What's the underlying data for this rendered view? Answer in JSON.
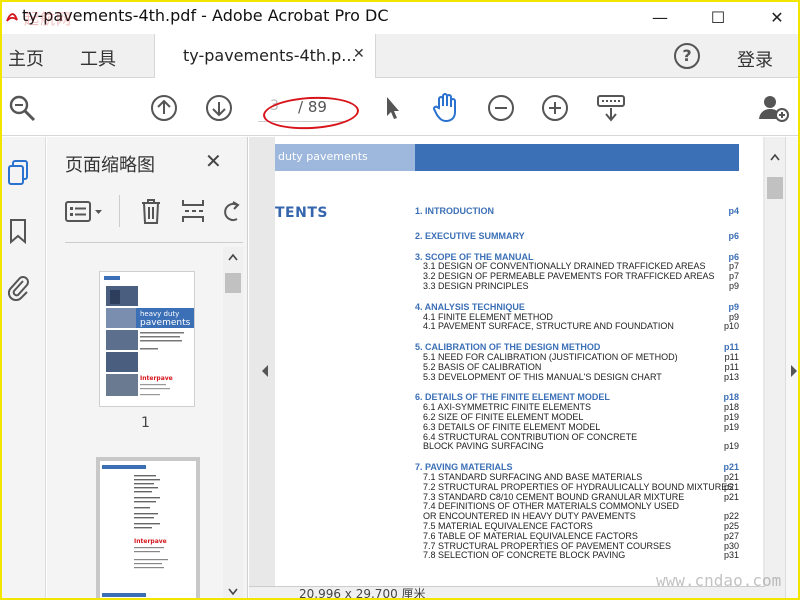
{
  "window": {
    "title": "ty-pavements-4th.pdf - Adobe Acrobat Pro DC",
    "minimize": "—",
    "maximize": "☐",
    "close": "✕"
  },
  "menu": {
    "home": "主页",
    "tools": "工具",
    "login": "登录",
    "help": "?"
  },
  "tab": {
    "label": "ty-pavements-4th.p...",
    "close": "✕"
  },
  "toolbar": {
    "current_page": "3",
    "page_total": "/ 89",
    "icons": [
      "zoom-icon",
      "page-up-icon",
      "page-down-icon",
      "select-cursor-icon",
      "hand-tool-icon",
      "zoom-out-icon",
      "zoom-in-icon",
      "keyboard-scroll-icon",
      "add-user-icon"
    ]
  },
  "thumbnails": {
    "title": "页面缩略图",
    "close": "✕",
    "page1_number": "1"
  },
  "document": {
    "banner": "duty pavements",
    "heading": "TENTS",
    "toc": [
      {
        "kind": "sec",
        "title": "1. INTRODUCTION",
        "page": "p4"
      },
      {
        "kind": "sec",
        "title": "2. EXECUTIVE SUMMARY",
        "page": "p6"
      },
      {
        "kind": "sec",
        "title": "3. SCOPE OF THE MANUAL",
        "page": "p6"
      },
      {
        "kind": "sub",
        "title": "3.1 DESIGN OF CONVENTIONALLY DRAINED TRAFFICKED AREAS",
        "page": "p7"
      },
      {
        "kind": "sub",
        "title": "3.2 DESIGN OF PERMEABLE PAVEMENTS FOR TRAFFICKED AREAS",
        "page": "p7"
      },
      {
        "kind": "sub",
        "title": "3.3 DESIGN PRINCIPLES",
        "page": "p9"
      },
      {
        "kind": "sec",
        "title": "4. ANALYSIS TECHNIQUE",
        "page": "p9"
      },
      {
        "kind": "sub",
        "title": "4.1 FINITE ELEMENT METHOD",
        "page": "p9"
      },
      {
        "kind": "sub",
        "title": "4.1 PAVEMENT SURFACE, STRUCTURE AND FOUNDATION",
        "page": "p10"
      },
      {
        "kind": "sec",
        "title": "5. CALIBRATION OF THE DESIGN METHOD",
        "page": "p11"
      },
      {
        "kind": "sub",
        "title": "5.1 NEED FOR CALIBRATION (JUSTIFICATION OF METHOD)",
        "page": "p11"
      },
      {
        "kind": "sub",
        "title": "5.2 BASIS OF CALIBRATION",
        "page": "p11"
      },
      {
        "kind": "sub",
        "title": "5.3 DEVELOPMENT OF THIS MANUAL'S DESIGN CHART",
        "page": "p13"
      },
      {
        "kind": "sec",
        "title": "6. DETAILS OF THE FINITE ELEMENT MODEL",
        "page": "p18"
      },
      {
        "kind": "sub",
        "title": "6.1 AXI-SYMMETRIC FINITE ELEMENTS",
        "page": "p18"
      },
      {
        "kind": "sub",
        "title": "6.2 SIZE OF FINITE ELEMENT MODEL",
        "page": "p19"
      },
      {
        "kind": "sub",
        "title": "6.3 DETAILS OF FINITE ELEMENT MODEL",
        "page": "p19"
      },
      {
        "kind": "sub",
        "title": "6.4 STRUCTURAL CONTRIBUTION OF CONCRETE",
        "page": ""
      },
      {
        "kind": "sub",
        "title": "     BLOCK PAVING SURFACING",
        "page": "p19"
      },
      {
        "kind": "sec",
        "title": "7. PAVING MATERIALS",
        "page": "p21"
      },
      {
        "kind": "sub",
        "title": "7.1 STANDARD SURFACING AND BASE MATERIALS",
        "page": "p21"
      },
      {
        "kind": "sub",
        "title": "7.2 STRUCTURAL PROPERTIES OF HYDRAULICALLY BOUND MIXTURES",
        "page": "p21"
      },
      {
        "kind": "sub",
        "title": "7.3 STANDARD C8/10 CEMENT BOUND GRANULAR MIXTURE",
        "page": "p21"
      },
      {
        "kind": "sub",
        "title": "7.4 DEFINITIONS OF OTHER MATERIALS COMMONLY USED",
        "page": ""
      },
      {
        "kind": "sub",
        "title": "     OR ENCOUNTERED IN HEAVY DUTY PAVEMENTS",
        "page": "p22"
      },
      {
        "kind": "sub",
        "title": "7.5 MATERIAL EQUIVALENCE FACTORS",
        "page": "p25"
      },
      {
        "kind": "sub",
        "title": "7.6 TABLE OF MATERIAL EQUIVALENCE FACTORS",
        "page": "p27"
      },
      {
        "kind": "sub",
        "title": "7.7 STRUCTURAL PROPERTIES OF PAVEMENT COURSES",
        "page": "p30"
      },
      {
        "kind": "sub",
        "title": "7.8 SELECTION OF CONCRETE BLOCK PAVING",
        "page": "p31"
      }
    ]
  },
  "status": {
    "page_size": "20.996 x 29.700 厘米"
  },
  "watermarks": {
    "top_left": "起航网",
    "bottom_right": "www.cndao.com"
  },
  "colors": {
    "accent_blue": "#3b6fb6",
    "light_blue": "#9eb8dd",
    "highlight_red": "#d8141b",
    "hand_tool_blue": "#2b72d0"
  }
}
